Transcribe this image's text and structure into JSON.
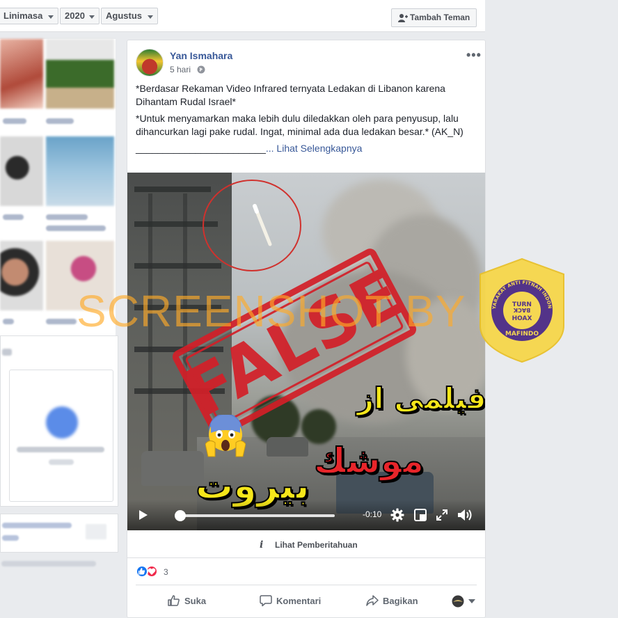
{
  "filters": {
    "timeline": "Linimasa",
    "year": "2020",
    "month": "Agustus"
  },
  "header": {
    "add_friend_label": "Tambah Teman"
  },
  "post": {
    "author": "Yan Ismahara",
    "time": "5 hari",
    "paragraphs": [
      "*Berdasar Rekaman Video Infrared ternyata Ledakan di Libanon karena Dihantam Rudal Israel*",
      "*Untuk menyamarkan maka lebih dulu diledakkan oleh para penyusup, lalu dihancurkan lagi pake rudal. Ingat, minimal ada dua ledakan besar.* (AK_N)"
    ],
    "separator": "________________________",
    "see_more": "... Lihat Selengkapnya",
    "video": {
      "stamp_text": "FALSE",
      "overlay_lines": [
        "فیلمی از",
        "موشك",
        "بیروت"
      ],
      "time_remaining": "-0:10",
      "progress_fraction": 0.0
    },
    "warning_label": "Lihat Pemberitahuan",
    "reaction_count": "3",
    "actions": {
      "like": "Suka",
      "comment": "Komentari",
      "share": "Bagikan"
    }
  },
  "watermark": "SCREENSHOT BY",
  "badge": {
    "arc_text": "MASYARAKAT ANTI FITNAH INDONESIA",
    "line1": "TURN",
    "line2": "BACK",
    "line3": "HOAX",
    "bottom": "MAFINDO"
  },
  "colors": {
    "link_blue": "#385898",
    "stamp_red": "#d31f28",
    "watermark_orange": "#ffaa28",
    "badge_yellow": "#f6d64a",
    "badge_purple": "#4b2a84"
  }
}
